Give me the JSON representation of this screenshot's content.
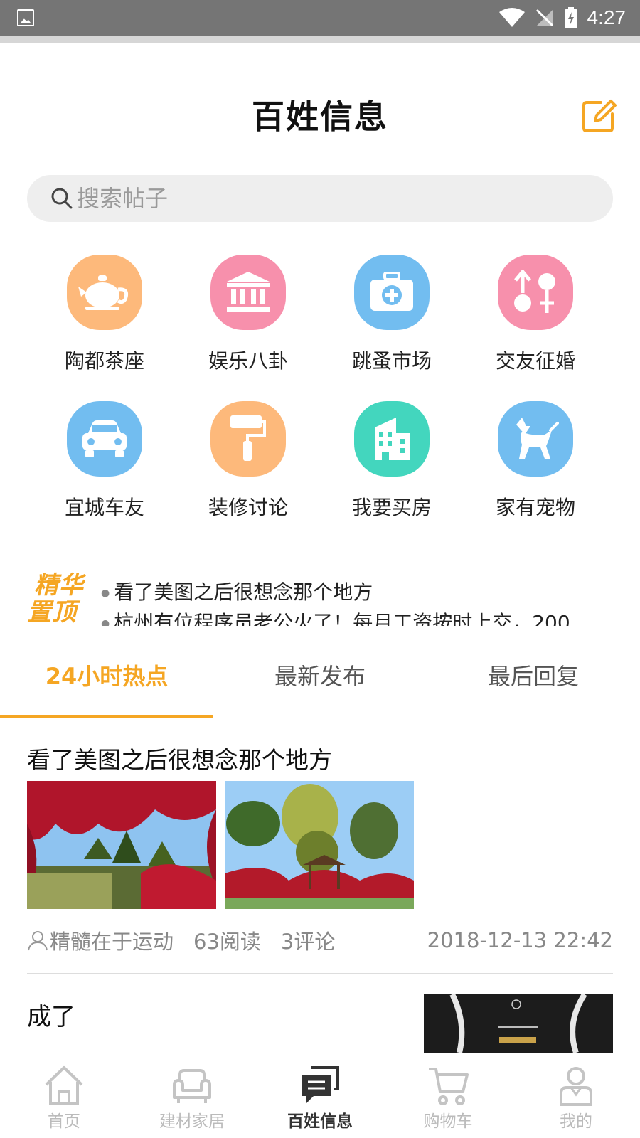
{
  "status_bar": {
    "time": "4:27",
    "icons": [
      "image-icon",
      "wifi-icon",
      "no-signal-icon",
      "battery-charging-icon"
    ]
  },
  "header": {
    "title": "百姓信息",
    "edit_icon": "edit-icon"
  },
  "search": {
    "placeholder": "搜索帖子",
    "icon": "search-icon"
  },
  "categories": [
    {
      "label": "陶都茶座",
      "icon": "teapot-icon",
      "color": "#fdb97b"
    },
    {
      "label": "娱乐八卦",
      "icon": "bank-icon",
      "color": "#f790ac"
    },
    {
      "label": "跳蚤市场",
      "icon": "medkit-icon",
      "color": "#72bdf0"
    },
    {
      "label": "交友征婚",
      "icon": "gender-icon",
      "color": "#f790ac"
    },
    {
      "label": "宜城车友",
      "icon": "car-icon",
      "color": "#72bdf0"
    },
    {
      "label": "装修讨论",
      "icon": "paint-roller-icon",
      "color": "#fdb97b"
    },
    {
      "label": "我要买房",
      "icon": "building-icon",
      "color": "#43d6be"
    },
    {
      "label": "家有宠物",
      "icon": "dog-icon",
      "color": "#72bdf0"
    }
  ],
  "featured": {
    "badge_line1": "精华",
    "badge_line2": "置顶",
    "items": [
      "看了美图之后很想念那个地方",
      "杭州有位程序员老公火了！每月工资按时上交，200"
    ]
  },
  "tabs": [
    {
      "label": "24小时热点",
      "active": true
    },
    {
      "label": "最新发布",
      "active": false
    },
    {
      "label": "最后回复",
      "active": false
    }
  ],
  "posts": [
    {
      "title": "看了美图之后很想念那个地方",
      "author": "精髓在于运动",
      "reads": "63阅读",
      "comments": "3评论",
      "date": "2018-12-13 22:42"
    },
    {
      "title": "成了"
    }
  ],
  "bottom_nav": [
    {
      "label": "首页",
      "icon": "home-icon",
      "active": false
    },
    {
      "label": "建材家居",
      "icon": "sofa-icon",
      "active": false
    },
    {
      "label": "百姓信息",
      "icon": "chat-icon",
      "active": true
    },
    {
      "label": "购物车",
      "icon": "cart-icon",
      "active": false
    },
    {
      "label": "我的",
      "icon": "user-icon",
      "active": false
    }
  ],
  "colors": {
    "accent": "#f5a623",
    "statusbar": "#757575"
  }
}
